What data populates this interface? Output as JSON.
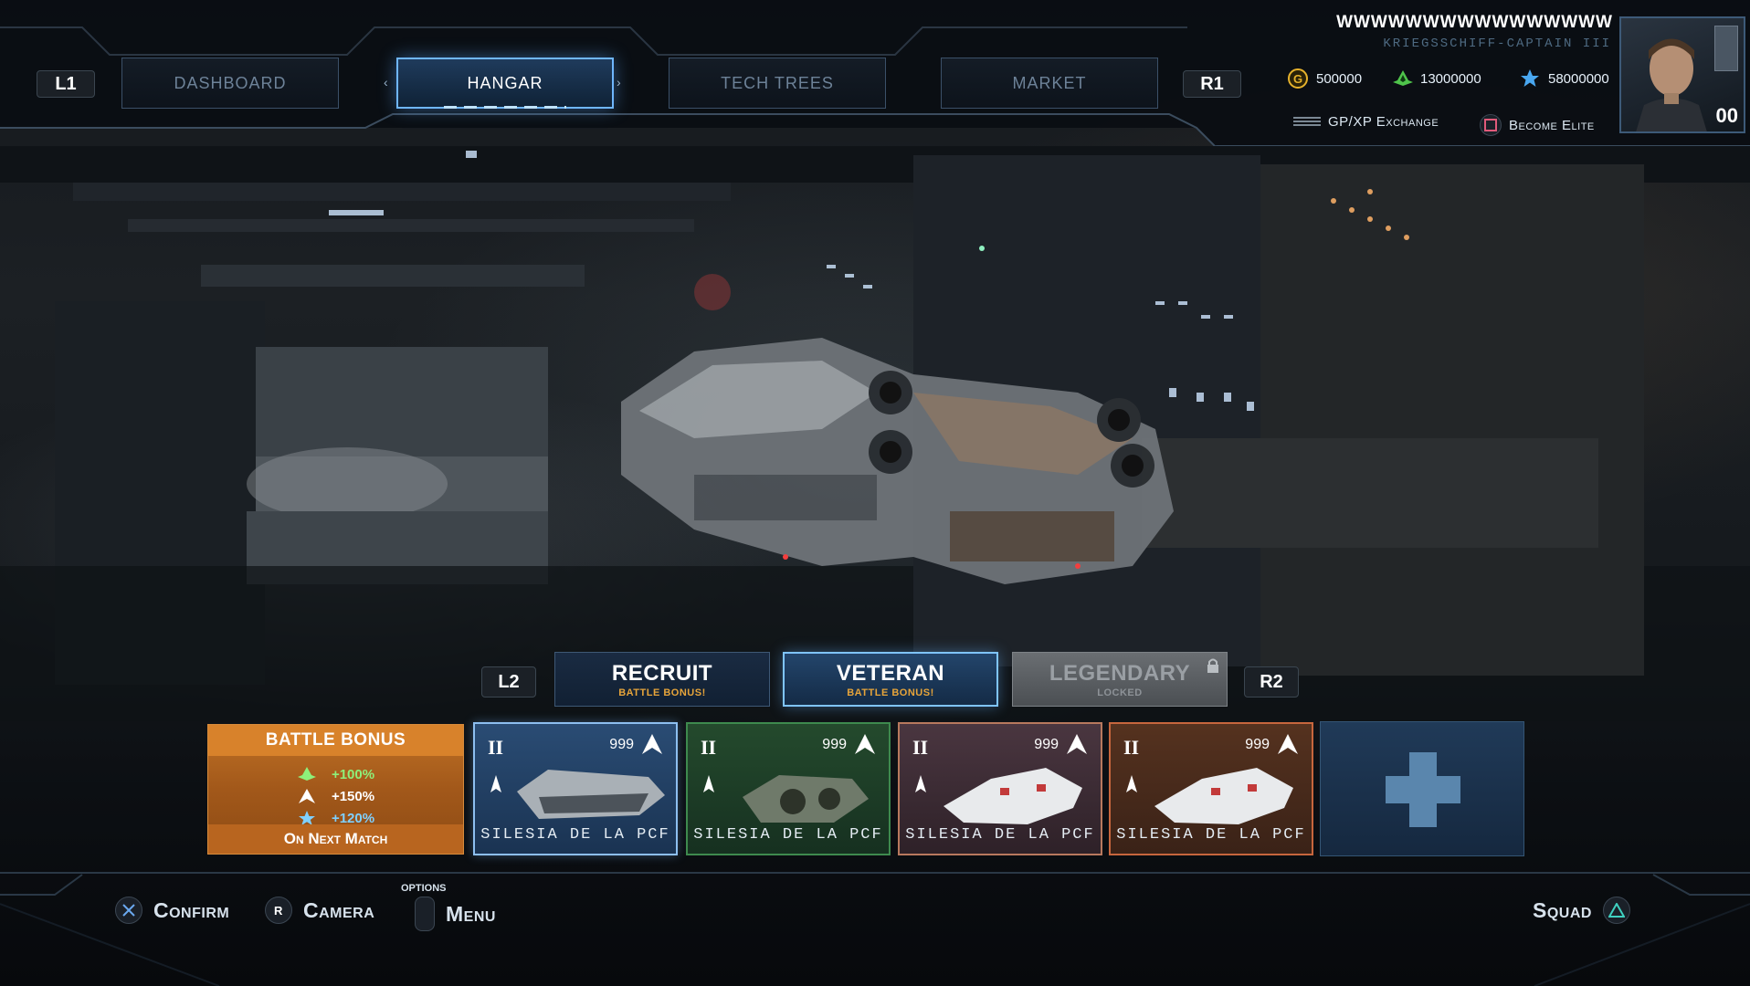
{
  "nav": {
    "left_bumper": "L1",
    "right_bumper": "R1",
    "tabs": [
      "DASHBOARD",
      "HANGAR",
      "TECH TREES",
      "MARKET"
    ],
    "active_tab": "HANGAR",
    "arrow_left": "‹",
    "arrow_right": "›"
  },
  "player": {
    "name": "WWWWWWWWWWWWWWWW",
    "rank_title": "KRIEGSSCHIFF-CAPTAIN III",
    "level": "00",
    "currencies": [
      {
        "icon": "gold-coin-icon",
        "value": "500000",
        "color": "#e6b22c"
      },
      {
        "icon": "green-emblem-icon",
        "value": "13000000",
        "color": "#4fc44b"
      },
      {
        "icon": "blue-star-icon",
        "value": "58000000",
        "color": "#49a7f0"
      }
    ],
    "links": {
      "exchange": "GP/XP Exchange",
      "elite": "Become Elite"
    }
  },
  "tiers": {
    "left_trigger": "L2",
    "right_trigger": "R2",
    "items": [
      {
        "title": "RECRUIT",
        "subtitle": "BATTLE BONUS!",
        "state": "normal"
      },
      {
        "title": "VETERAN",
        "subtitle": "BATTLE BONUS!",
        "state": "active"
      },
      {
        "title": "LEGENDARY",
        "subtitle": "LOCKED",
        "state": "locked"
      }
    ]
  },
  "battle_bonus": {
    "title": "BATTLE BONUS",
    "rows": [
      {
        "icon": "green-emblem-icon",
        "value": "+100%",
        "color": "#8ef07a"
      },
      {
        "icon": "rank-chevron-icon",
        "value": "+150%",
        "color": "#ffffff"
      },
      {
        "icon": "blue-star-icon",
        "value": "+120%",
        "color": "#7fd0ff"
      }
    ],
    "footer": "On Next Match"
  },
  "ships": [
    {
      "tier": "II",
      "count": "999",
      "name": "SILESIA DE LA PCF",
      "theme": "blue"
    },
    {
      "tier": "II",
      "count": "999",
      "name": "SILESIA DE LA PCF",
      "theme": "green"
    },
    {
      "tier": "II",
      "count": "999",
      "name": "SILESIA DE LA PCF",
      "theme": "plum"
    },
    {
      "tier": "II",
      "count": "999",
      "name": "SILESIA DE LA PCF",
      "theme": "rust"
    }
  ],
  "hints": {
    "confirm": "Confirm",
    "camera": "Camera",
    "camera_btn": "R",
    "options": "OPTIONS",
    "menu": "Menu",
    "squad": "Squad"
  }
}
